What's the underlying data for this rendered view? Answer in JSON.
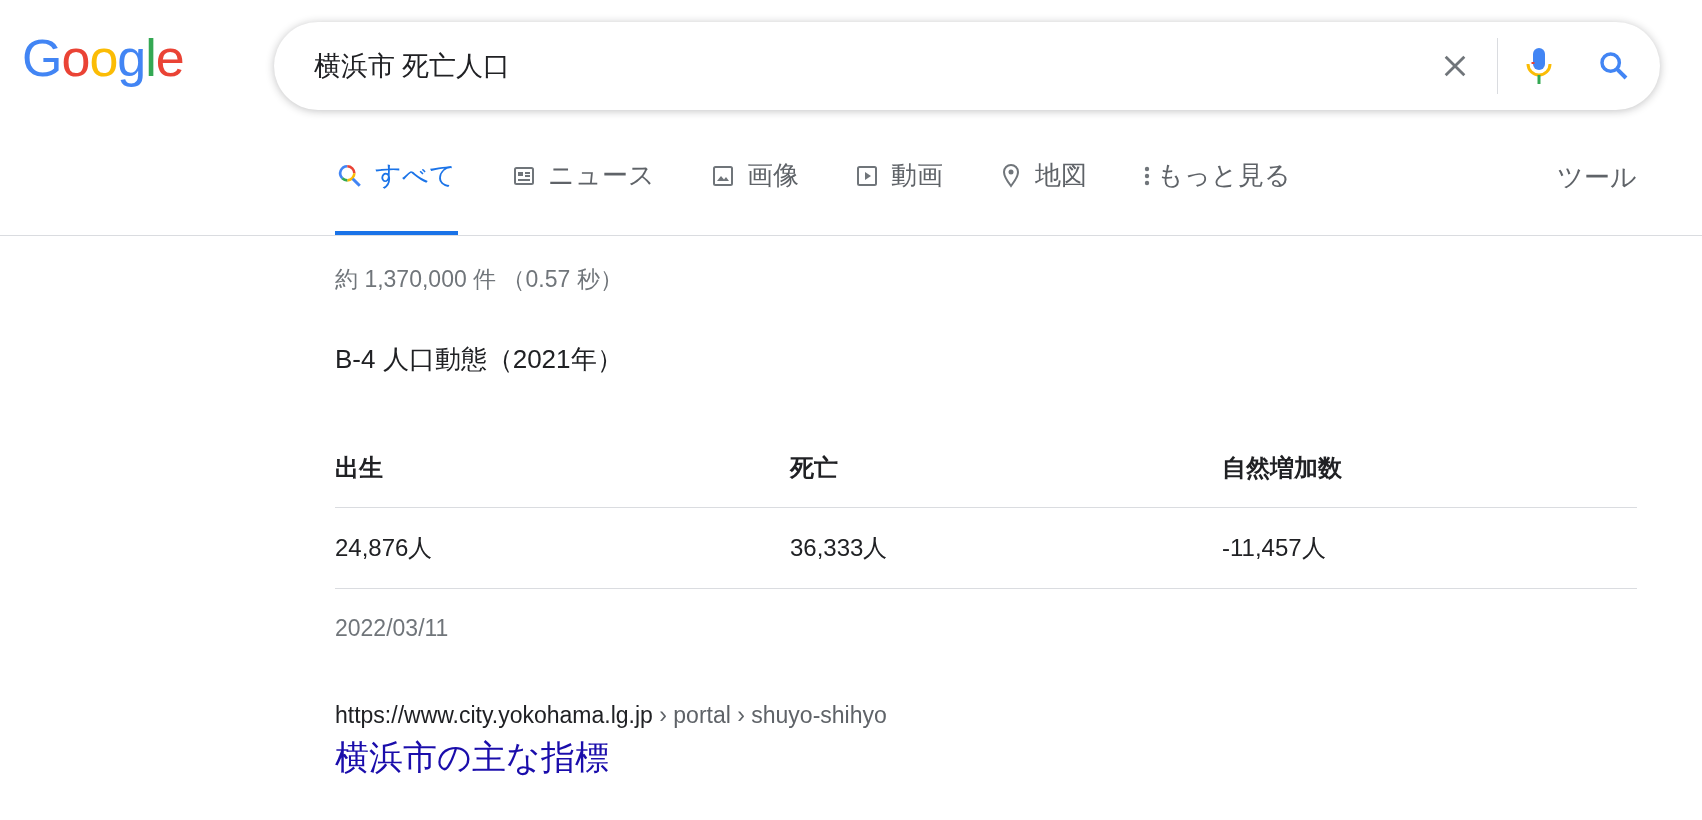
{
  "logo": {
    "text": "Google"
  },
  "search": {
    "value": "横浜市 死亡人口"
  },
  "tabs": [
    {
      "label": "すべて",
      "kind": "all",
      "selected": true
    },
    {
      "label": "ニュース",
      "kind": "news",
      "selected": false
    },
    {
      "label": "画像",
      "kind": "images",
      "selected": false
    },
    {
      "label": "動画",
      "kind": "videos",
      "selected": false
    },
    {
      "label": "地図",
      "kind": "maps",
      "selected": false
    },
    {
      "label": "もっと見る",
      "kind": "more",
      "selected": false
    }
  ],
  "tools": "ツール",
  "result_stats": "約 1,370,000 件 （0.57 秒）",
  "snippet": {
    "title": "B-4 人口動態（2021年）",
    "table": {
      "columns": [
        "出生",
        "死亡",
        "自然増加数"
      ],
      "rows": [
        [
          "24,876人",
          "36,333人",
          "-11,457人"
        ]
      ]
    },
    "date": "2022/03/11",
    "url": {
      "host": "https://www.city.yokohama.lg.jp",
      "path": " › portal › shuyo-shihyo"
    },
    "link_title": "横浜市の主な指標"
  }
}
